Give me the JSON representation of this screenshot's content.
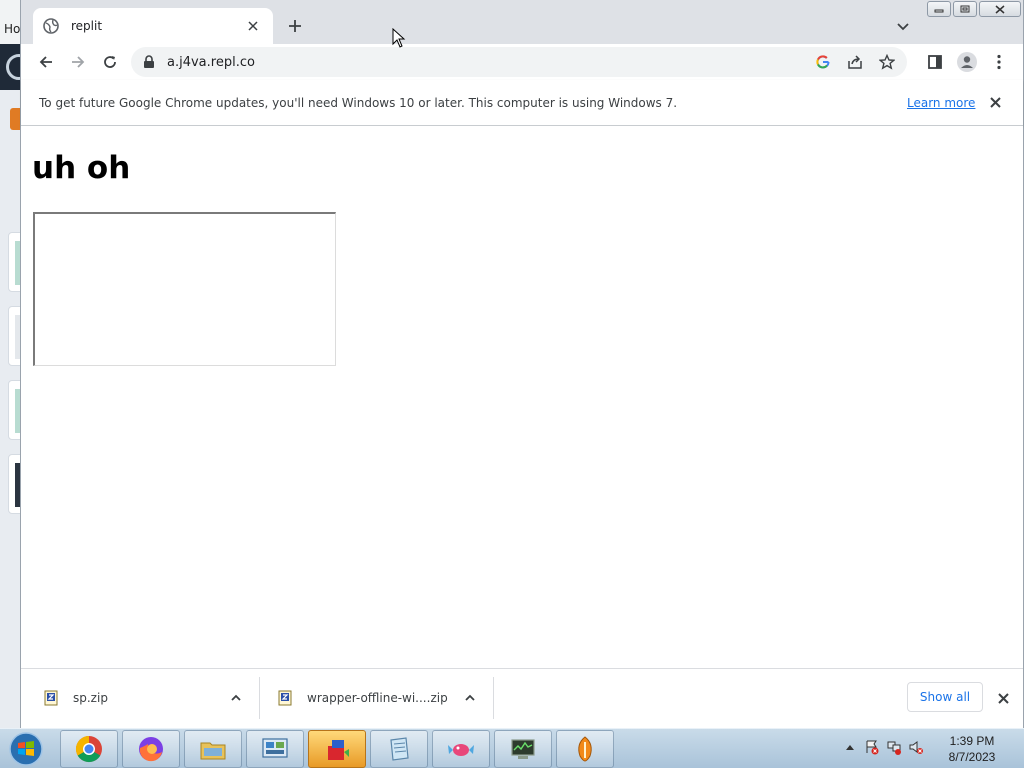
{
  "background_window": {
    "tab_text": "Ho"
  },
  "browser": {
    "tab": {
      "title": "replit"
    },
    "address_bar": {
      "url": "a.j4va.repl.co"
    },
    "infobar": {
      "message": "To get future Google Chrome updates, you'll need Windows 10 or later. This computer is using Windows 7.",
      "link_label": "Learn more"
    }
  },
  "page": {
    "heading": "uh oh"
  },
  "downloads": {
    "items": [
      {
        "name": "sp.zip"
      },
      {
        "name": "wrapper-offline-wi....zip"
      }
    ],
    "show_all_label": "Show all"
  },
  "taskbar": {
    "apps": [
      "chrome-icon",
      "firefox-icon",
      "file-explorer-icon",
      "control-panel-icon",
      "app-builder-icon",
      "notepad-icon",
      "candy-app-icon",
      "system-monitor-icon",
      "fl-studio-icon"
    ],
    "clock": {
      "time": "1:39 PM",
      "date": "8/7/2023"
    }
  },
  "colors": {
    "link": "#1a73e8",
    "tabbar": "#dee1e6",
    "taskbar": "#b8cfe2"
  }
}
